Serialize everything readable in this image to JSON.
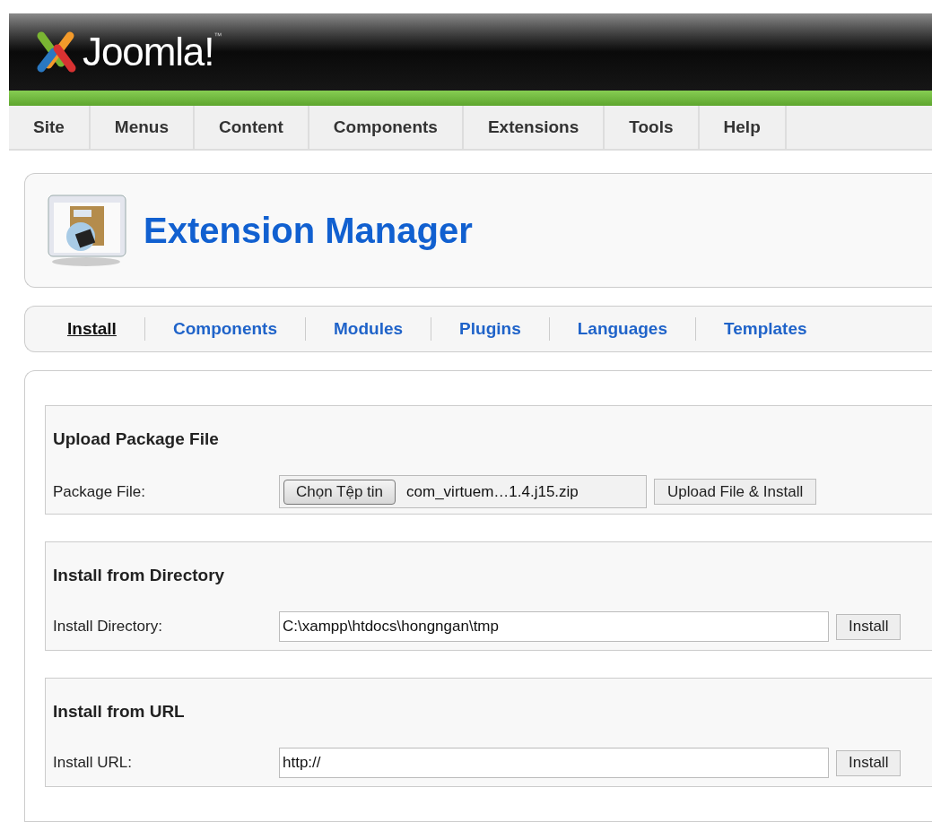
{
  "header": {
    "logo": "Joomla!",
    "trademark": "™"
  },
  "menu": [
    {
      "label": "Site"
    },
    {
      "label": "Menus"
    },
    {
      "label": "Content"
    },
    {
      "label": "Components"
    },
    {
      "label": "Extensions"
    },
    {
      "label": "Tools"
    },
    {
      "label": "Help"
    }
  ],
  "page_title": "Extension Manager",
  "submenu": [
    {
      "label": "Install",
      "selected": true
    },
    {
      "label": "Components",
      "selected": false
    },
    {
      "label": "Modules",
      "selected": false
    },
    {
      "label": "Plugins",
      "selected": false
    },
    {
      "label": "Languages",
      "selected": false
    },
    {
      "label": "Templates",
      "selected": false
    }
  ],
  "sections": [
    {
      "kind": "file",
      "title": "Upload Package File",
      "label": "Package File:",
      "choose_button": "Chọn Tệp tin",
      "file_name": "com_virtuem…1.4.j15.zip",
      "button": "Upload File & Install"
    },
    {
      "kind": "text",
      "title": "Install from Directory",
      "label": "Install Directory:",
      "value": "C:\\xampp\\htdocs\\hongngan\\tmp",
      "button": "Install"
    },
    {
      "kind": "text",
      "title": "Install from URL",
      "label": "Install URL:",
      "value": "http://",
      "button": "Install"
    }
  ]
}
